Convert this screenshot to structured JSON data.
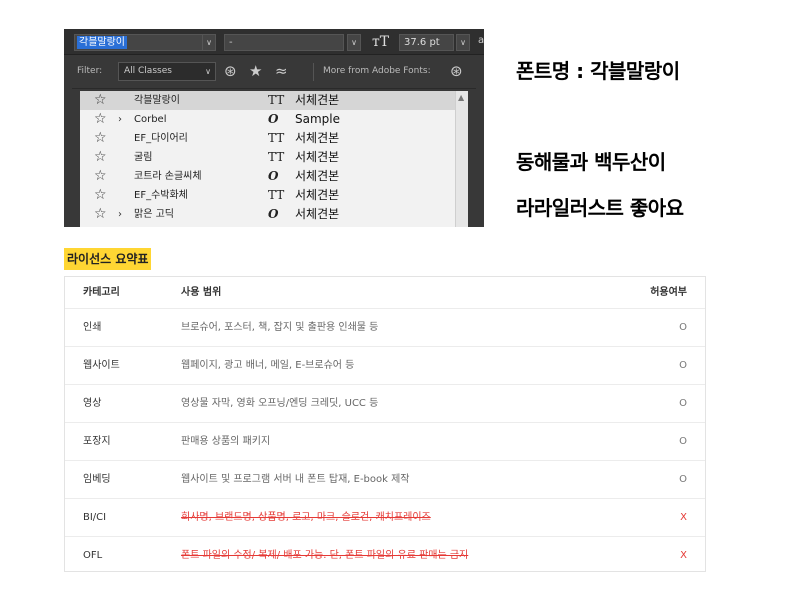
{
  "ps_panel": {
    "font_selected": "각블말랑이",
    "style_value": "-",
    "size_value": "37.6 pt",
    "clipped_char": "a",
    "filter_label": "Filter:",
    "filter_class": "All Classes",
    "more_fonts": "More from Adobe Fonts:",
    "fonts": [
      {
        "name": "각블말랑이",
        "type": "TT",
        "sample": "서체견본",
        "expand": "",
        "highlighted": true
      },
      {
        "name": "Corbel",
        "type": "O",
        "sample": "Sample",
        "expand": "›",
        "highlighted": false
      },
      {
        "name": "EF_다이어리",
        "type": "TT",
        "sample": "서체견본",
        "expand": "",
        "highlighted": false
      },
      {
        "name": "굴림",
        "type": "TT",
        "sample": "서체견본",
        "expand": "",
        "highlighted": false
      },
      {
        "name": "코트라 손글씨체",
        "type": "O",
        "sample": "서체견본",
        "expand": "",
        "highlighted": false
      },
      {
        "name": "EF_수박화체",
        "type": "TT",
        "sample": "서체견본",
        "expand": "",
        "highlighted": false
      },
      {
        "name": "맑은 고딕",
        "type": "O",
        "sample": "서체견본",
        "expand": "›",
        "highlighted": false
      }
    ]
  },
  "side": {
    "font_name_line": "폰트명 : 각블말랑이",
    "sample_line_1": "동해물과 백두산이",
    "sample_line_2": "라라일러스트 좋아요"
  },
  "license": {
    "title": "라이선스 요약표",
    "headers": {
      "category": "카테고리",
      "scope": "사용 범위",
      "allowed": "허용여부"
    },
    "rows": [
      {
        "category": "인쇄",
        "scope": "브로슈어, 포스터, 책, 잡지 및 출판용 인쇄물 등",
        "allowed": "O",
        "ok": true
      },
      {
        "category": "웹사이트",
        "scope": "웹페이지, 광고 배너, 메일, E-브로슈어 등",
        "allowed": "O",
        "ok": true
      },
      {
        "category": "영상",
        "scope": "영상물 자막, 영화 오프닝/엔딩 크레딧, UCC 등",
        "allowed": "O",
        "ok": true
      },
      {
        "category": "포장지",
        "scope": "판매용 상품의 패키지",
        "allowed": "O",
        "ok": true
      },
      {
        "category": "임베딩",
        "scope": "웹사이트 및 프로그램 서버 내 폰트 탑재, E-book 제작",
        "allowed": "O",
        "ok": true
      },
      {
        "category": "BI/CI",
        "scope": "회사명, 브랜드명, 상품명, 로고, 마크, 슬로건, 캐치프레이즈",
        "allowed": "X",
        "ok": false
      },
      {
        "category": "OFL",
        "scope": "폰트 파일의 수정/ 복제/ 배포 가능. 단, 폰트 파일의 유료 판매는 금지",
        "allowed": "X",
        "ok": false
      }
    ]
  },
  "colors": {
    "highlight_yellow": "#ffd633",
    "deny_red": "#e53935",
    "ps_select_blue": "#2a6fd6"
  }
}
